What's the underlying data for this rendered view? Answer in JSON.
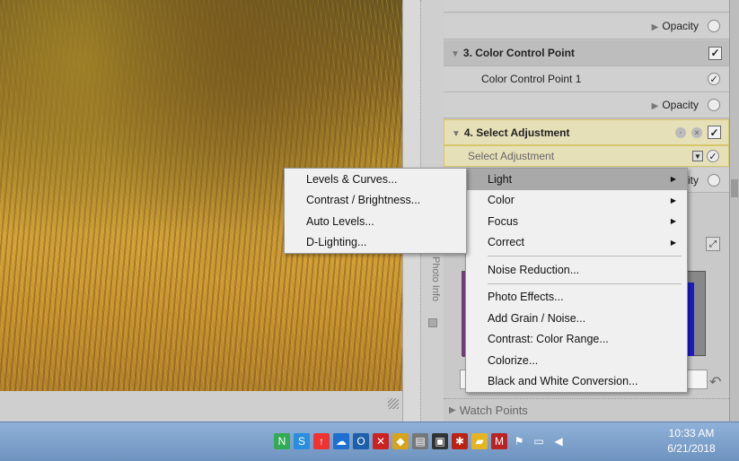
{
  "panel": {
    "opacity_label": "Opacity",
    "ccp_header": "3. Color Control Point",
    "ccp_item": "Color Control Point 1",
    "select_header": "4. Select Adjustment",
    "select_dropdown": "Select Adjustment",
    "partial_opacity": "ity",
    "watch_points": "Watch Points"
  },
  "vstrip": {
    "photo_info": "Photo Info"
  },
  "main_menu": [
    {
      "label": "Light",
      "submenu": true,
      "highlighted": true
    },
    {
      "label": "Color",
      "submenu": true
    },
    {
      "label": "Focus",
      "submenu": true
    },
    {
      "label": "Correct",
      "submenu": true
    },
    {
      "label": "Noise Reduction...",
      "separator_before": true
    },
    {
      "label": "Photo Effects...",
      "separator_before": true
    },
    {
      "label": "Add Grain / Noise..."
    },
    {
      "label": "Contrast: Color Range..."
    },
    {
      "label": "Colorize..."
    },
    {
      "label": "Black and White Conversion..."
    }
  ],
  "sub_menu": [
    {
      "label": "Levels & Curves..."
    },
    {
      "label": "Contrast / Brightness..."
    },
    {
      "label": "Auto Levels..."
    },
    {
      "label": "D-Lighting..."
    }
  ],
  "taskbar": {
    "time": "10:33 AM",
    "date": "6/21/2018"
  }
}
